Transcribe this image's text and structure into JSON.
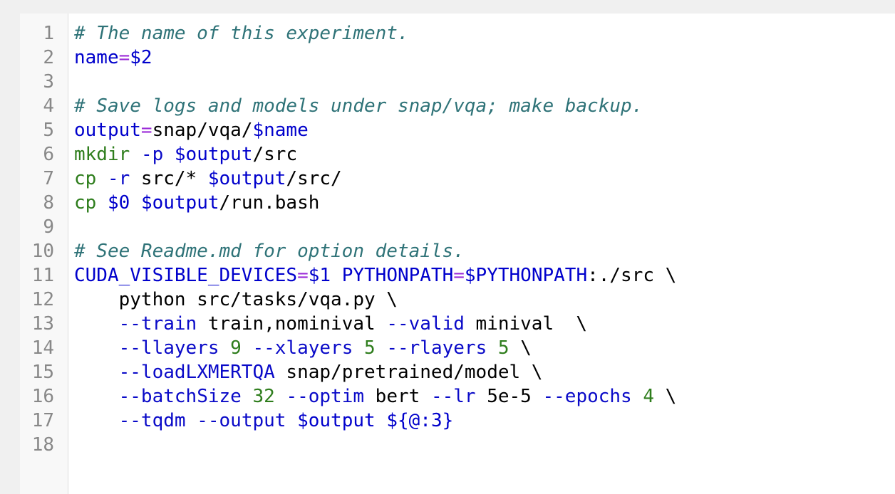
{
  "editor": {
    "lines": [
      {
        "number": "1",
        "tokens": [
          {
            "text": "# The name of this experiment.",
            "type": "comment"
          }
        ]
      },
      {
        "number": "2",
        "tokens": [
          {
            "text": "name",
            "type": "var"
          },
          {
            "text": "=",
            "type": "op"
          },
          {
            "text": "$2",
            "type": "var"
          }
        ]
      },
      {
        "number": "3",
        "tokens": []
      },
      {
        "number": "4",
        "tokens": [
          {
            "text": "# Save logs and models under snap/vqa; make backup.",
            "type": "comment"
          }
        ]
      },
      {
        "number": "5",
        "tokens": [
          {
            "text": "output",
            "type": "var"
          },
          {
            "text": "=",
            "type": "op"
          },
          {
            "text": "snap/vqa/",
            "type": "plain"
          },
          {
            "text": "$name",
            "type": "var"
          }
        ]
      },
      {
        "number": "6",
        "tokens": [
          {
            "text": "mkdir",
            "type": "cmd"
          },
          {
            "text": " ",
            "type": "plain"
          },
          {
            "text": "-p",
            "type": "flag"
          },
          {
            "text": " ",
            "type": "plain"
          },
          {
            "text": "$output",
            "type": "var"
          },
          {
            "text": "/src",
            "type": "plain"
          }
        ]
      },
      {
        "number": "7",
        "tokens": [
          {
            "text": "cp",
            "type": "cmd"
          },
          {
            "text": " ",
            "type": "plain"
          },
          {
            "text": "-r",
            "type": "flag"
          },
          {
            "text": " src/* ",
            "type": "plain"
          },
          {
            "text": "$output",
            "type": "var"
          },
          {
            "text": "/src/",
            "type": "plain"
          }
        ]
      },
      {
        "number": "8",
        "tokens": [
          {
            "text": "cp",
            "type": "cmd"
          },
          {
            "text": " ",
            "type": "plain"
          },
          {
            "text": "$0",
            "type": "var"
          },
          {
            "text": " ",
            "type": "plain"
          },
          {
            "text": "$output",
            "type": "var"
          },
          {
            "text": "/run.bash",
            "type": "plain"
          }
        ]
      },
      {
        "number": "9",
        "tokens": []
      },
      {
        "number": "10",
        "tokens": [
          {
            "text": "# See Readme.md for option details.",
            "type": "comment"
          }
        ]
      },
      {
        "number": "11",
        "tokens": [
          {
            "text": "CUDA_VISIBLE_DEVICES",
            "type": "var"
          },
          {
            "text": "=",
            "type": "op"
          },
          {
            "text": "$1",
            "type": "var"
          },
          {
            "text": " ",
            "type": "plain"
          },
          {
            "text": "PYTHONPATH",
            "type": "var"
          },
          {
            "text": "=",
            "type": "op"
          },
          {
            "text": "$PYTHONPATH",
            "type": "var"
          },
          {
            "text": ":./src \\",
            "type": "plain"
          }
        ]
      },
      {
        "number": "12",
        "tokens": [
          {
            "text": "    python src/tasks/vqa.py \\",
            "type": "plain"
          }
        ]
      },
      {
        "number": "13",
        "tokens": [
          {
            "text": "    ",
            "type": "plain"
          },
          {
            "text": "--train",
            "type": "flag"
          },
          {
            "text": " train,nominival ",
            "type": "plain"
          },
          {
            "text": "--valid",
            "type": "flag"
          },
          {
            "text": " minival  \\",
            "type": "plain"
          }
        ]
      },
      {
        "number": "14",
        "tokens": [
          {
            "text": "    ",
            "type": "plain"
          },
          {
            "text": "--llayers",
            "type": "flag"
          },
          {
            "text": " ",
            "type": "plain"
          },
          {
            "text": "9",
            "type": "num"
          },
          {
            "text": " ",
            "type": "plain"
          },
          {
            "text": "--xlayers",
            "type": "flag"
          },
          {
            "text": " ",
            "type": "plain"
          },
          {
            "text": "5",
            "type": "num"
          },
          {
            "text": " ",
            "type": "plain"
          },
          {
            "text": "--rlayers",
            "type": "flag"
          },
          {
            "text": " ",
            "type": "plain"
          },
          {
            "text": "5",
            "type": "num"
          },
          {
            "text": " \\",
            "type": "plain"
          }
        ]
      },
      {
        "number": "15",
        "tokens": [
          {
            "text": "    ",
            "type": "plain"
          },
          {
            "text": "--loadLXMERTQA",
            "type": "flag"
          },
          {
            "text": " snap/pretrained/model \\",
            "type": "plain"
          }
        ]
      },
      {
        "number": "16",
        "tokens": [
          {
            "text": "    ",
            "type": "plain"
          },
          {
            "text": "--batchSize",
            "type": "flag"
          },
          {
            "text": " ",
            "type": "plain"
          },
          {
            "text": "32",
            "type": "num"
          },
          {
            "text": " ",
            "type": "plain"
          },
          {
            "text": "--optim",
            "type": "flag"
          },
          {
            "text": " bert ",
            "type": "plain"
          },
          {
            "text": "--lr",
            "type": "flag"
          },
          {
            "text": " 5e-5 ",
            "type": "plain"
          },
          {
            "text": "--epochs",
            "type": "flag"
          },
          {
            "text": " ",
            "type": "plain"
          },
          {
            "text": "4",
            "type": "num"
          },
          {
            "text": " \\",
            "type": "plain"
          }
        ]
      },
      {
        "number": "17",
        "tokens": [
          {
            "text": "    ",
            "type": "plain"
          },
          {
            "text": "--tqdm",
            "type": "flag"
          },
          {
            "text": " ",
            "type": "plain"
          },
          {
            "text": "--output",
            "type": "flag"
          },
          {
            "text": " ",
            "type": "plain"
          },
          {
            "text": "$output",
            "type": "var"
          },
          {
            "text": " ",
            "type": "plain"
          },
          {
            "text": "${@:3}",
            "type": "var"
          }
        ]
      },
      {
        "number": "18",
        "tokens": []
      }
    ]
  },
  "colors": {
    "comment": "#2f7378",
    "variable": "#0000cc",
    "operator": "#9b2bd8",
    "command": "#2e7d1c",
    "flag": "#0a0ac8",
    "number": "#2e7d1c",
    "plain": "#000000"
  }
}
